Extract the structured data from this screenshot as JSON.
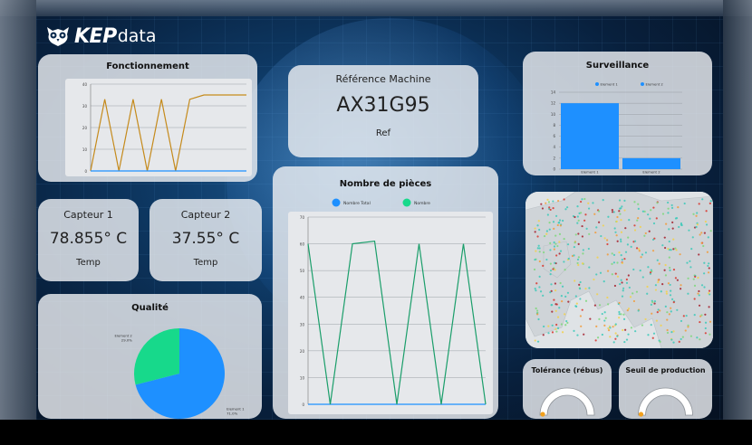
{
  "brand": {
    "kep": "KEP",
    "data": "data"
  },
  "fonctionnement": {
    "title": "Fonctionnement",
    "chart_data": {
      "type": "line",
      "y_ticks": [
        "0",
        "10",
        "20",
        "30",
        "40"
      ],
      "ylim": [
        0,
        40
      ],
      "x": [
        0,
        1,
        2,
        3,
        4,
        5,
        6,
        7,
        8,
        9,
        10,
        11
      ],
      "series": [
        {
          "values": [
            0,
            33,
            0,
            33,
            0,
            33,
            0,
            33,
            35,
            35,
            35,
            35
          ],
          "color": "#c58a1b"
        },
        {
          "values": [
            0,
            0,
            0,
            0,
            0,
            0,
            0,
            0,
            0,
            0,
            0,
            0
          ],
          "color": "#1e90ff"
        }
      ]
    }
  },
  "reference": {
    "label": "Référence Machine",
    "value": "AX31G95",
    "sub": "Ref"
  },
  "surveillance": {
    "title": "Surveillance",
    "chart_data": {
      "type": "bar",
      "categories": [
        "Element 1",
        "Element 2"
      ],
      "values": [
        12,
        2
      ],
      "ylim": [
        0,
        14
      ],
      "y_ticks": [
        "0",
        "2",
        "4",
        "6",
        "8",
        "10",
        "12",
        "14"
      ],
      "series": [
        {
          "name": "Element 1",
          "color": "#1e90ff"
        },
        {
          "name": "Element 2",
          "color": "#1e90ff"
        }
      ]
    }
  },
  "capteur1": {
    "label": "Capteur 1",
    "value": "78.855° C",
    "unit": "Temp"
  },
  "capteur2": {
    "label": "Capteur 2",
    "value": "37.55° C",
    "unit": "Temp"
  },
  "pieces": {
    "title": "Nombre de pièces",
    "chart_data": {
      "type": "line",
      "y_ticks": [
        "0",
        "10",
        "20",
        "30",
        "40",
        "50",
        "60",
        "70"
      ],
      "ylim": [
        0,
        70
      ],
      "x": [
        0,
        1,
        2,
        3,
        4,
        5,
        6,
        7,
        8
      ],
      "series": [
        {
          "name": "Nombre Total",
          "color": "#1e90ff",
          "values": [
            0,
            0,
            0,
            0,
            0,
            0,
            0,
            0,
            0
          ]
        },
        {
          "name": "Nombre",
          "color": "#1a9e6a",
          "values": [
            60,
            0,
            60,
            61,
            0,
            60,
            0,
            60,
            0
          ]
        }
      ],
      "legend_colors": [
        "#1e90ff",
        "#17d98b"
      ]
    }
  },
  "qualite": {
    "title": "Qualité",
    "chart_data": {
      "type": "pie",
      "slices": [
        {
          "label": "Element 1",
          "pct": "71.0%",
          "value": 71.0,
          "color": "#1e90ff"
        },
        {
          "label": "Element 2",
          "pct": "29.0%",
          "value": 29.0,
          "color": "#17d98b"
        }
      ]
    }
  },
  "map": {
    "icon": "europe-heatmap-map"
  },
  "tolerance": {
    "title": "Tolérance (rébus)",
    "level": 0.0,
    "accent": "#f2a01c"
  },
  "seuil": {
    "title": "Seuil de production",
    "level": 0.0,
    "accent": "#f2a01c"
  }
}
